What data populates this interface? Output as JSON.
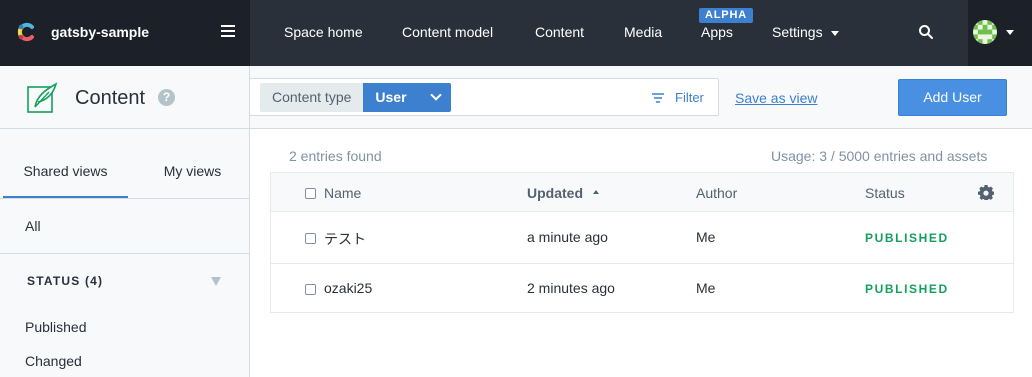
{
  "topbar": {
    "space_name": "gatsby-sample",
    "nav": [
      "Space home",
      "Content model",
      "Content",
      "Media",
      "Apps",
      "Settings"
    ],
    "apps_badge": "ALPHA"
  },
  "header": {
    "title": "Content",
    "help": "?",
    "content_type_label": "Content type",
    "content_type_value": "User",
    "filter_label": "Filter",
    "save_as_view": "Save as view",
    "add_button": "Add User"
  },
  "sidebar": {
    "tabs": [
      "Shared views",
      "My views"
    ],
    "all_label": "All",
    "status_heading": "STATUS (4)",
    "status_items": [
      "Published",
      "Changed"
    ]
  },
  "main": {
    "entries_found": "2 entries found",
    "usage": "Usage: 3 / 5000 entries and assets",
    "columns": [
      "Name",
      "Updated",
      "Author",
      "Status"
    ],
    "rows": [
      {
        "name": "テスト",
        "updated": "a minute ago",
        "author": "Me",
        "status": "PUBLISHED"
      },
      {
        "name": "ozaki25",
        "updated": "2 minutes ago",
        "author": "Me",
        "status": "PUBLISHED"
      }
    ]
  },
  "colors": {
    "topbar": "#2a3039",
    "accent": "#3c80cf",
    "published": "#14a05c"
  }
}
